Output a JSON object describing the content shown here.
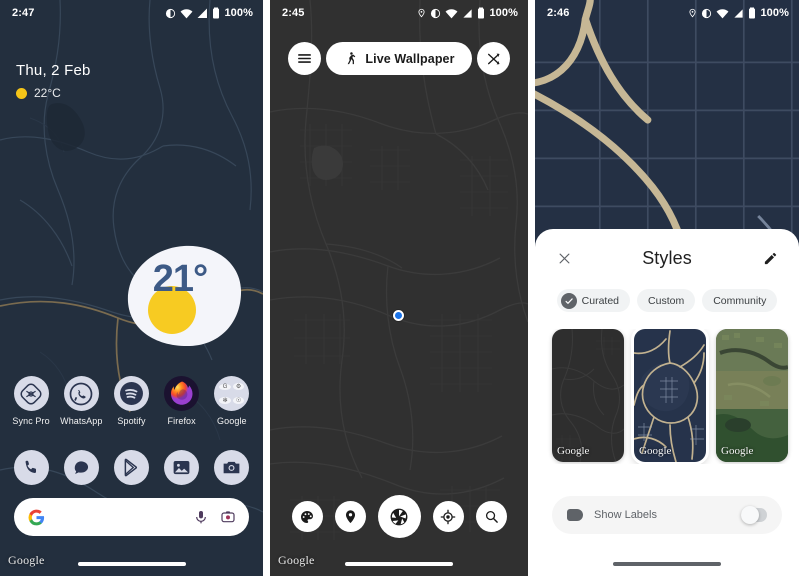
{
  "panels": {
    "home": {
      "status": {
        "time": "2:47",
        "battery": "100%"
      },
      "widget": {
        "date": "Thu, 2 Feb",
        "temp_small": "22°C",
        "temp_big": "21°"
      },
      "apps_row1": [
        {
          "label": "Sync Pro",
          "icon": "sync-pro-icon"
        },
        {
          "label": "WhatsApp",
          "icon": "whatsapp-icon"
        },
        {
          "label": "Spotify",
          "icon": "spotify-icon"
        },
        {
          "label": "Firefox",
          "icon": "firefox-icon"
        },
        {
          "label": "Google",
          "icon": "google-folder-icon"
        }
      ],
      "dock": [
        {
          "icon": "phone-icon"
        },
        {
          "icon": "messages-icon"
        },
        {
          "icon": "play-store-icon"
        },
        {
          "icon": "photos-icon"
        },
        {
          "icon": "camera-icon"
        }
      ],
      "search": {
        "placeholder": "",
        "value": "",
        "left_icon": "google-g-icon",
        "mic_icon": "microphone-icon",
        "lens_icon": "google-lens-icon"
      },
      "watermark": "Google"
    },
    "wallpaper": {
      "status": {
        "time": "2:45",
        "battery": "100%"
      },
      "menu_icon": "hamburger-menu-icon",
      "pill": {
        "label": "Live Wallpaper",
        "icon": "walking-person-icon"
      },
      "shuffle_icon": "shuffle-icon",
      "toolbar": [
        {
          "icon": "palette-icon"
        },
        {
          "icon": "map-pin-icon"
        },
        {
          "icon": "aperture-icon"
        },
        {
          "icon": "my-location-icon"
        },
        {
          "icon": "search-icon"
        }
      ],
      "watermark": "Google"
    },
    "styles": {
      "status": {
        "time": "2:46",
        "battery": "100%"
      },
      "sheet": {
        "title": "Styles",
        "close_icon": "close-icon",
        "edit_icon": "pencil-edit-icon",
        "chips": [
          {
            "label": "Curated",
            "selected": true
          },
          {
            "label": "Custom",
            "selected": false
          },
          {
            "label": "Community",
            "selected": false
          }
        ],
        "cards": [
          {
            "name": "dark-grey-style",
            "watermark": "Google",
            "selected": false
          },
          {
            "name": "navy-blue-style",
            "watermark": "Google",
            "selected": true
          },
          {
            "name": "satellite-style",
            "watermark": "Google",
            "selected": false
          }
        ],
        "labels_row": {
          "label": "Show Labels",
          "icon": "label-tag-icon",
          "enabled": false
        }
      }
    }
  },
  "colors": {
    "home_map_bg": "#232f3e",
    "wallpaper_map_bg": "#303030",
    "styles_map_bg": "#243044",
    "accent_blue": "#1a73e8",
    "sun_yellow": "#f5c518",
    "temp_text": "#3d5a86"
  }
}
